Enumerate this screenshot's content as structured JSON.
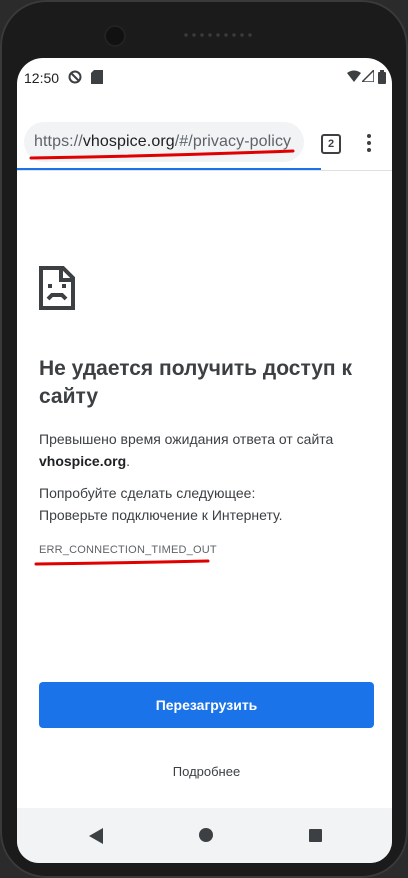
{
  "status_bar": {
    "time": "12:50"
  },
  "browser": {
    "url_scheme": "https://",
    "url_host": "vhospice.org",
    "url_path": "/#/privacy-policy",
    "tab_count": "2",
    "load_progress": 0.81
  },
  "error_page": {
    "title": "Не удается получить доступ к сайту",
    "description_prefix": "Превышено время ожидания ответа от сайта",
    "description_host": "vhospice.org",
    "description_suffix": ".",
    "try_heading": "Попробуйте сделать следующее:",
    "suggestion": "Проверьте подключение к Интернету.",
    "error_code": "ERR_CONNECTION_TIMED_OUT",
    "reload_label": "Перезагрузить",
    "details_label": "Подробнее"
  },
  "annotations": {
    "color": "#e10000"
  },
  "colors": {
    "accent": "#1a73e8"
  },
  "icons": [
    "sad-page-icon",
    "wifi-icon",
    "signal-icon",
    "battery-icon",
    "do-not-disturb-icon",
    "sd-card-icon",
    "overflow-menu-icon",
    "back-icon",
    "home-icon",
    "recent-apps-icon"
  ]
}
